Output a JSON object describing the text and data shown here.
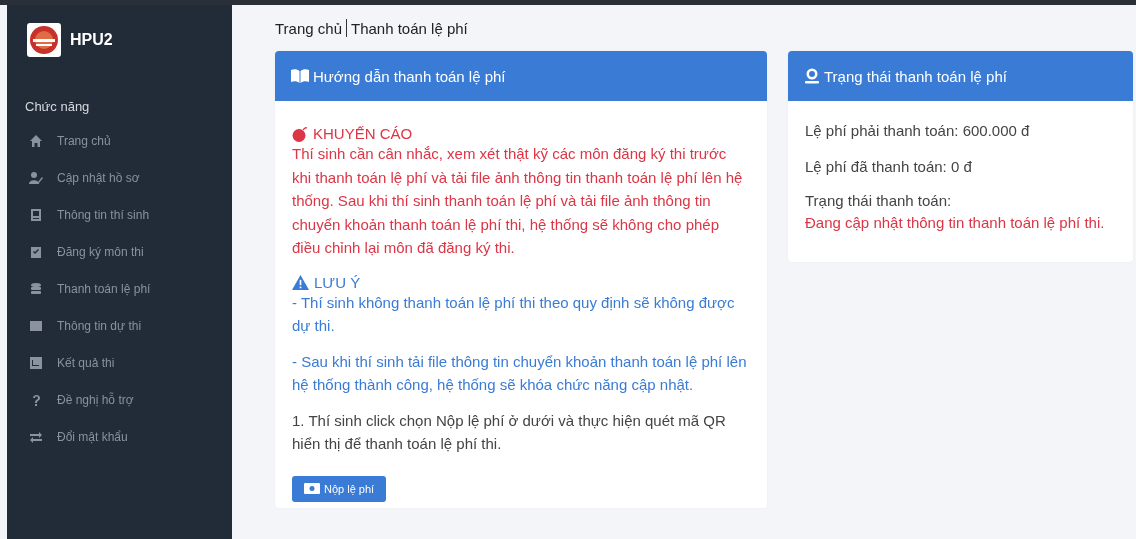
{
  "sidebar": {
    "brand": "HPU2",
    "section_title": "Chức năng",
    "items": [
      {
        "label": "Trang chủ"
      },
      {
        "label": "Cập nhật hồ sơ"
      },
      {
        "label": "Thông tin thí sinh"
      },
      {
        "label": "Đăng ký môn thi"
      },
      {
        "label": "Thanh toán lệ phí"
      },
      {
        "label": "Thông tin dự thi"
      },
      {
        "label": "Kết quả thi"
      },
      {
        "label": "Đề nghị hỗ trợ"
      },
      {
        "label": "Đổi mật khẩu"
      }
    ]
  },
  "breadcrumb": [
    "Trang chủ",
    "Thanh toán lệ phí"
  ],
  "guide_card": {
    "title": "Hướng dẫn thanh toán lệ phí",
    "blocks": [
      {
        "kind": "warning_heading",
        "text": "KHUYẾN CÁO"
      },
      {
        "kind": "warning",
        "text": "Thí sinh cần cân nhắc, xem xét thật kỹ các môn đăng ký thi trước khi thanh toán lệ phí và tải file ảnh thông tin thanh toán lệ phí lên hệ thống. Sau khi thí sinh thanh toán lệ phí và tải file ảnh thông tin chuyển khoản thanh toán lệ phí thi, hệ thống sẽ không cho phép điều chỉnh lại môn đã đăng ký thi."
      },
      {
        "kind": "note_heading",
        "text": "LƯU Ý"
      },
      {
        "kind": "note",
        "text": "- Thí sinh không thanh toán lệ phí thi theo quy định sẽ không được dự thi."
      },
      {
        "kind": "note",
        "text": "- Sau khi thí sinh tải file thông tin chuyển khoản thanh toán lệ phí lên hệ thống thành công, hệ thống sẽ khóa chức năng cập nhật."
      },
      {
        "kind": "step",
        "text": "1. Thí sinh click chọn Nộp lệ phí ở dưới và thực hiện quét mã QR hiển thị để thanh toán lệ phí thi."
      }
    ],
    "button": "Nộp lệ phí"
  },
  "status_card": {
    "title": "Trạng thái thanh toán lệ phí",
    "fee_due": "Lệ phí phải thanh toán: 600.000 đ",
    "fee_paid": "Lệ phí đã thanh toán: 0 đ",
    "status_label": "Trạng thái thanh toán:",
    "status_value": "Đang cập nhật thông tin thanh toán lệ phí thi."
  }
}
